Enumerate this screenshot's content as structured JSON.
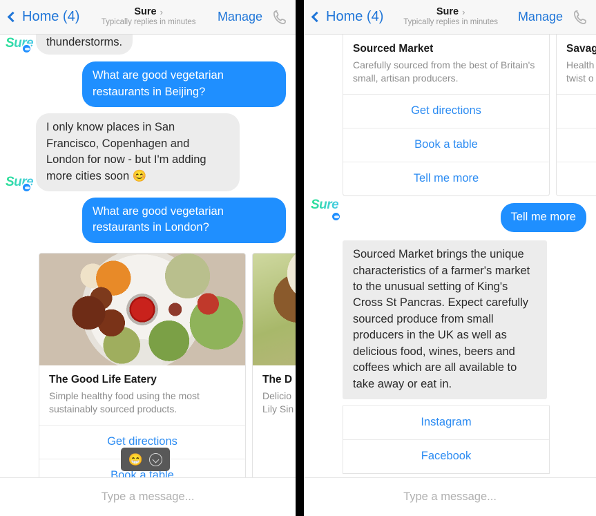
{
  "header": {
    "back_label": "Home (4)",
    "title": "Sure",
    "title_chevron": "›",
    "subtitle": "Typically replies in minutes",
    "manage_label": "Manage",
    "phone_icon": "phone-icon"
  },
  "left_panel": {
    "messages": [
      {
        "id": "m1",
        "side": "in",
        "text": "thunderstorms.",
        "clipped": true,
        "avatar": true
      },
      {
        "id": "m2",
        "side": "out",
        "text": "What are good vegetarian restaurants in Beijing?"
      },
      {
        "id": "m3",
        "side": "in",
        "text": "I only know places in San Francisco, Copenhagen and London for now - but I'm adding more cities soon 😊",
        "avatar": true
      },
      {
        "id": "m4",
        "side": "out",
        "text": "What are good vegetarian restaurants in London?"
      }
    ],
    "avatar_name": "Sure",
    "cards": [
      {
        "id": "c1",
        "image": "salad-bowl-photo",
        "title": "The Good Life Eatery",
        "subtitle": "Simple healthy food using the most sustainably sourced products.",
        "buttons": [
          "Get directions",
          "Book a table"
        ]
      },
      {
        "id": "c2",
        "image": "salad-plate-photo",
        "title": "The D",
        "subtitle_line1": "Delicio",
        "subtitle_line2": "Lily Sin",
        "buttons": []
      }
    ],
    "emoji_tooltip": {
      "emoji": "😁",
      "chevron_icon": "chevron-down-circle-icon"
    },
    "composer_placeholder": "Type a message..."
  },
  "right_panel": {
    "avatar_name": "Sure",
    "cards": [
      {
        "id": "rc1",
        "title": "Sourced Market",
        "subtitle": "Carefully sourced from the best of Britain's small, artisan producers.",
        "buttons": [
          "Get directions",
          "Book a table",
          "Tell me more"
        ]
      },
      {
        "id": "rc2",
        "title": "Savag",
        "subtitle_line1": "Health",
        "subtitle_line2": "twist o",
        "buttons": []
      }
    ],
    "messages": [
      {
        "id": "rm1",
        "side": "out",
        "text": "Tell me more"
      },
      {
        "id": "rm2",
        "side": "in",
        "text": "Sourced Market brings the unique characteristics of a farmer's market to the unusual setting of King's Cross St Pancras. Expect carefully sourced produce from small producers in the UK as well as delicious food, wines, beers and coffees which are all available to take away or eat in."
      }
    ],
    "link_buttons": [
      "Instagram",
      "Facebook"
    ],
    "composer_placeholder": "Type a message..."
  },
  "colors": {
    "accent_blue": "#1f8fff",
    "link_blue": "#2b8bf2",
    "header_blue": "#2076d8",
    "incoming_bubble": "#ececec",
    "brand_green": "#2fd98a",
    "divider_black": "#000000"
  }
}
